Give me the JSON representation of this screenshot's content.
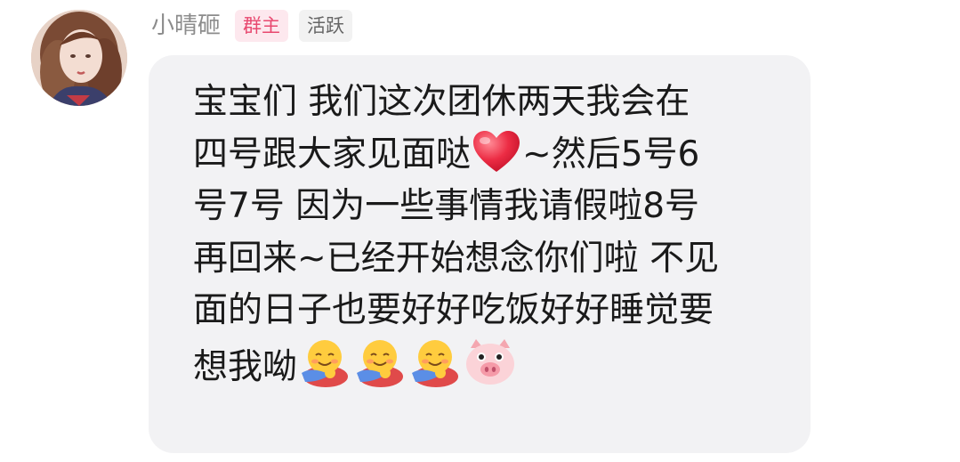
{
  "sender": {
    "name": "小晴砸",
    "badges": [
      "群主",
      "活跃"
    ],
    "avatar": "avatar"
  },
  "message": {
    "lines": [
      "宝宝们 我们这次团休两天我会在",
      "四号跟大家见面哒",
      "~然后5号6",
      "号7号 因为一些事情我请假啦8号",
      "再回来~已经开始想念你们啦 不见",
      "面的日子也要好好吃饭好好睡觉要",
      "想我呦"
    ],
    "emojis": [
      "heart-icon",
      "hug-icon",
      "hug-icon",
      "hug-icon",
      "pig-face-icon"
    ]
  },
  "colors": {
    "bubble": "#f2f2f4",
    "owner_badge_bg": "#fde8ee",
    "owner_badge_text": "#e8486f",
    "active_badge_bg": "#f2f2f2",
    "name_text": "#8c8c8c",
    "heart": "#e8233c"
  }
}
